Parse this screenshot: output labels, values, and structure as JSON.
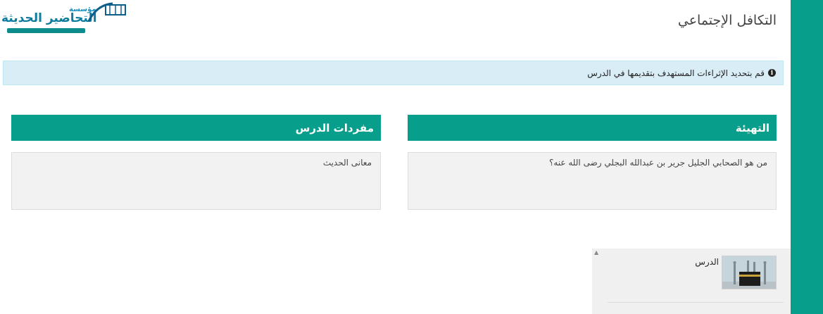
{
  "header": {
    "logo_top": "مؤسسة",
    "logo_main": "التحاضير الحديثة",
    "page_title": "التكافل الإجتماعي"
  },
  "alert": {
    "icon": "info-icon",
    "text": "قم بتحديد الإثراءات المستهدف بتقديمها في الدرس"
  },
  "panels": {
    "intro": {
      "title": "التهيئة",
      "body": "من هو الصحابي الجليل جرير بن عبدالله البجلي رضى الله عنه؟"
    },
    "vocab": {
      "title": "مفردات الدرس",
      "body": "معانى الحديث"
    }
  },
  "lesson": {
    "label": "الدرس",
    "thumb_icon": "kaaba-icon"
  },
  "colors": {
    "accent": "#089e8c",
    "alert_bg": "#d9edf7",
    "panel_bg": "#f2f2f2"
  }
}
